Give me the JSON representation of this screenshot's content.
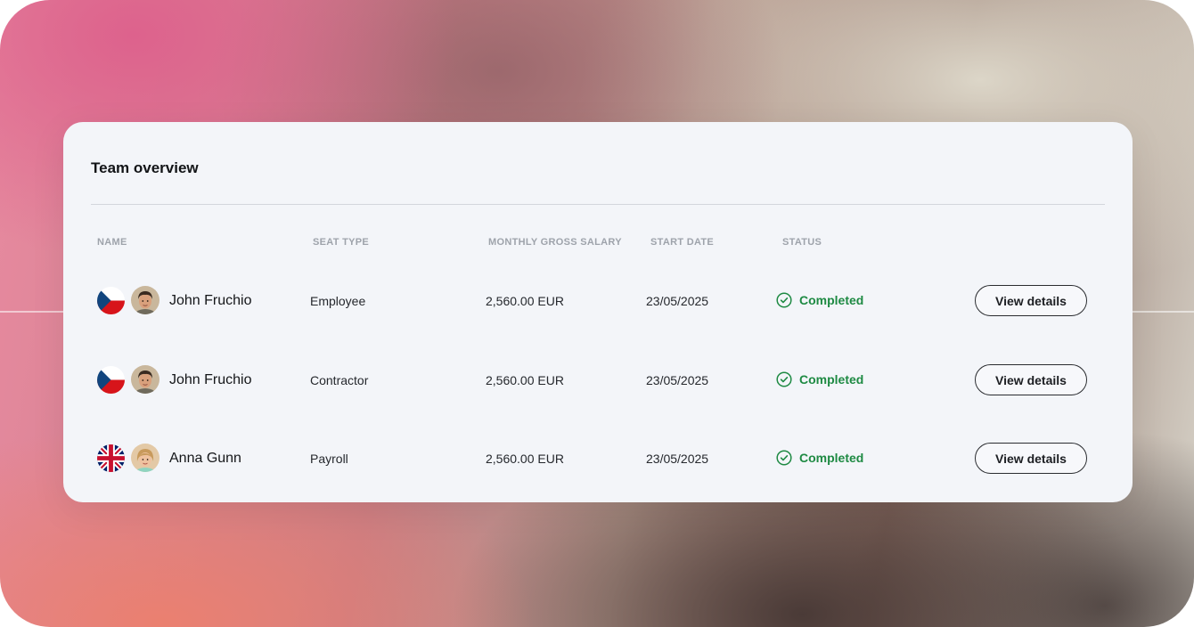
{
  "card": {
    "title": "Team overview"
  },
  "table": {
    "headers": [
      "NAME",
      "SEAT TYPE",
      "MONTHLY GROSS SALARY",
      "START DATE",
      "STATUS"
    ],
    "rows": [
      {
        "flag": "czech-flag",
        "avatar": "male-avatar",
        "name": "John Fruchio",
        "seat_type": "Employee",
        "salary": "2,560.00 EUR",
        "start_date": "23/05/2025",
        "status": "Completed",
        "action": "View details"
      },
      {
        "flag": "czech-flag",
        "avatar": "male-avatar",
        "name": "John Fruchio",
        "seat_type": "Contractor",
        "salary": "2,560.00 EUR",
        "start_date": "23/05/2025",
        "status": "Completed",
        "action": "View details"
      },
      {
        "flag": "uk-flag",
        "avatar": "female-avatar",
        "name": "Anna Gunn",
        "seat_type": "Payroll",
        "salary": "2,560.00 EUR",
        "start_date": "23/05/2025",
        "status": "Completed",
        "action": "View details"
      }
    ]
  },
  "colors": {
    "status_completed": "#1e8a43",
    "card_background": "#f3f5f9",
    "header_text": "#9ea3ab"
  },
  "icons": {
    "status": "check-circle-icon"
  }
}
